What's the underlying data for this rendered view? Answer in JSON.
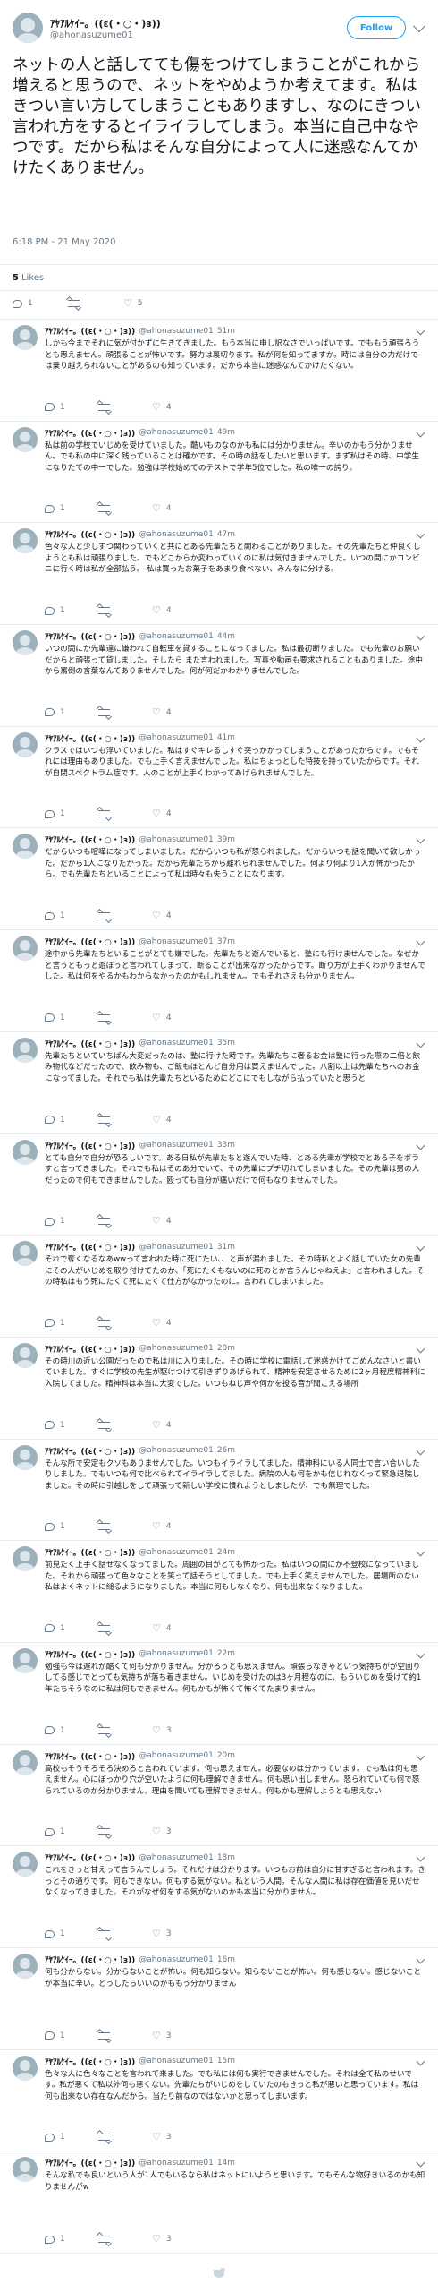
{
  "main_tweet": {
    "display_name": "ｱﾔｱﾙｹｲｰ。((ε(・○・)з))",
    "handle": "@ahonasuzume01",
    "follow_label": "Follow",
    "text": "ネットの人と話してても傷をつけてしまうことがこれから増えると思うので、ネットをやめようか考えてます。私はきつい言い方してしまうこともありますし、なのにきつい言われ方をするとイライラしてしまう。本当に自己中なやつです。だから私はそんな自分によって人に迷惑なんてかけたくありません。",
    "timestamp": "6:18 PM - 21 May 2020",
    "likes_count": "5",
    "likes_label": "Likes",
    "reply_count": "1",
    "retweet_count": "",
    "like_count": "5"
  },
  "replies": [
    {
      "name": "ｱﾔｱﾙｹｲｰ。((ε(・○・)з))",
      "handle": "@ahonasuzume01",
      "time": "51m",
      "text": "しかも今までそれに気が付かずに生きてきました。もう本当に申し訳なさでいっぱいです。でももう頑張ろうとも思えません。頑張ることが怖いです。努力は裏切ります。私が何を知ってますか。時には自分の力だけでは乗り越えられないことがあるのも知っています。だから本当に迷惑なんてかけたくない。",
      "replies": "1",
      "retweets": "",
      "likes": "4"
    },
    {
      "name": "ｱﾔｱﾙｹｲｰ。((ε(・○・)з))",
      "handle": "@ahonasuzume01",
      "time": "49m",
      "text": "私は前の学校でいじめを受けていました。酷いものなのかも私には分かりません。辛いのかもう分かりません。でも私の中に深く残っていることは確かです。その時の話をしたいと思います。まず私はその時、中学生になりたての中一でした。勉強は学校始めてのテストで学年5位でした。私の唯一の誇り。",
      "replies": "1",
      "retweets": "",
      "likes": "4"
    },
    {
      "name": "ｱﾔｱﾙｹｲｰ。((ε(・○・)з))",
      "handle": "@ahonasuzume01",
      "time": "47m",
      "text": "色々な人と少しずつ関わっていくと共にとある先輩たちと関わることがありました。その先輩たちと仲良くしようとも私は頑張りました。でもどこからか変わっていくのに私は気付きませんでした。いつの間にかコンビニに行く時は私が全部払う。\n私は買ったお菓子をあまり食べない、みんなに分ける。",
      "replies": "1",
      "retweets": "",
      "likes": "4"
    },
    {
      "name": "ｱﾔｱﾙｹｲｰ。((ε(・○・)з))",
      "handle": "@ahonasuzume01",
      "time": "44m",
      "text": "いつの間にか先輩達に嫌われて自転車を貸することになってました。私は最初断りました。でも先輩のお願いだからと頑張って貸しました。そしたら また言われました。写真や動画も要求されることもありました。途中から罵倒の言葉なんてありませんでした。何が何だかわかりませんでした。",
      "replies": "1",
      "retweets": "",
      "likes": "4"
    },
    {
      "name": "ｱﾔｱﾙｹｲｰ。((ε(・○・)з))",
      "handle": "@ahonasuzume01",
      "time": "41m",
      "text": "クラスではいつも浮いていました。私はすぐキレるしすぐ突っかかってしまうことがあったからです。でもそれには理由もありました。でも上手く言えませんでした。私はちょっとした特技を持っていたからです。それが自閉スペクトラム症です。人のことが上手くわかってあげられませんでした。",
      "replies": "1",
      "retweets": "",
      "likes": "4"
    },
    {
      "name": "ｱﾔｱﾙｹｲｰ。((ε(・○・)з))",
      "handle": "@ahonasuzume01",
      "time": "39m",
      "text": "だからいつも喧嘩になってしまいました。だからいつも私が怒られました。だからいつも話を聞いて欲しかった。だから1人になりたかった。だから先輩たちから離れられませんでした。何より何より1人が怖かったから。でも先輩たちといることによって私は時々も失うことになります。",
      "replies": "1",
      "retweets": "",
      "likes": "4"
    },
    {
      "name": "ｱﾔｱﾙｹｲｰ。((ε(・○・)з))",
      "handle": "@ahonasuzume01",
      "time": "37m",
      "text": "途中から先輩たちといることがとても嫌でした。先輩たちと遊んでいると、塾にも行けませんでした。なぜかと言うともっと遊ぼうと言われてしまって、断ることが出来なかったからです。断り方が上手くわかりませんでした。私は何をやるかもわからなかったのかもしれません。でもそれさえも分かりません。",
      "replies": "1",
      "retweets": "",
      "likes": "4"
    },
    {
      "name": "ｱﾔｱﾙｹｲｰ。((ε(・○・)з))",
      "handle": "@ahonasuzume01",
      "time": "35m",
      "text": "先輩たちといていちばん大変だったのは、塾に行けた時です。先輩たちに奢るお金は塾に行った際の二倍と飲み物代などだったので、飲み物も、ご飯もほとんど自分用は買えませんでした。八割以上は先輩たちへのお金になってました。それでも私は先輩たちといるためにどこにでもしながら払っていたと思うと",
      "replies": "1",
      "retweets": "",
      "likes": "4"
    },
    {
      "name": "ｱﾔｱﾙｹｲｰ。((ε(・○・)з))",
      "handle": "@ahonasuzume01",
      "time": "33m",
      "text": "とても自分で自分が恐ろしいです。ある日私が先輩たちと遊んでいた時、とある先輩が学校でとある子をボラすと言ってきました。それでも私はそのあ分でいて、その先輩にブチ切れてしまいました。その先輩は男の人だったので何もできませんでした。殴っても自分が痛いだけで何もなりませんでした。",
      "replies": "1",
      "retweets": "",
      "likes": "4"
    },
    {
      "name": "ｱﾔｱﾙｹｲｰ。((ε(・○・)з))",
      "handle": "@ahonasuzume01",
      "time": "31m",
      "text": "それで奪くなるなあwwって言われた時に死にたい、、と声が漏れました。その時私とよく話していた女の先輩にその人がいじめを取り付けてたのか、「死にたくもないのに死のとか言うんじゃねえよ」と言われました。その時私はもう死にたくて死にたくて仕方がなかったのに。言われてしまいました。",
      "replies": "1",
      "retweets": "",
      "likes": "4"
    },
    {
      "name": "ｱﾔｱﾙｹｲｰ。((ε(・○・)з))",
      "handle": "@ahonasuzume01",
      "time": "28m",
      "text": "その時川の近い公園だったので私は川に入りました。その時に学校に電話して迷惑かけてごめんなさいと書いていました。すぐに学校の先生が駆けつけて引きずりあげられて、精神を安定させるために2ヶ月程度精神科に入院してました。精神科は本当に大変でした。いつもねじ声や何かを投る音が聞こえる場所",
      "replies": "1",
      "retweets": "",
      "likes": "4"
    },
    {
      "name": "ｱﾔｱﾙｹｲｰ。((ε(・○・)з))",
      "handle": "@ahonasuzume01",
      "time": "26m",
      "text": "そんな所で安定もクソもありませんでした。いつもイライラしてました。精神科にいる人同士で言い合いしたりしました。でもいつも何で比べられてイライラしてました。病院の人も何をかも信じれなくって緊急退院しました。その時に引越しをして頑張って新しい学校に慣れようとしましたが、でも無理でした。",
      "replies": "1",
      "retweets": "",
      "likes": "4"
    },
    {
      "name": "ｱﾔｱﾙｹｲｰ。((ε(・○・)з))",
      "handle": "@ahonasuzume01",
      "time": "24m",
      "text": "前見たく上手く話せなくなってました。周囲の目がとても怖かった。私はいつの間にか不登校になっていました。それから頑張って色々なことを笑って話そうとしてました。でも上手く笑えませんでした。居場所のない私はよくネットに縋るようになりました。本当に何もしなくなり、何も出来なくなりました。",
      "replies": "1",
      "retweets": "",
      "likes": "4"
    },
    {
      "name": "ｱﾔｱﾙｹｲｰ。((ε(・○・)з))",
      "handle": "@ahonasuzume01",
      "time": "22m",
      "text": "勉強も今は遅れが酷くて何も分かりません。分かろうとも思えません。頑張らなきゃという気持ちがが空回りしてる感じでとっても気持ちが落ち着きません。いじめを受けたのは3ヶ月程なのに、もういじめを受けて約1年たちそうなのに私は何もできません。何もかもが怖くて怖くてたまりません。",
      "replies": "1",
      "retweets": "",
      "likes": "3"
    },
    {
      "name": "ｱﾔｱﾙｹｲｰ。((ε(・○・)з))",
      "handle": "@ahonasuzume01",
      "time": "20m",
      "text": "高校もそうそろそろ決めろと言われています。何も思えません。必要なのは分かっています。でも私は何も思えません。心にぽっかり穴が空いたように何も理解できません。何も思い出しません。怒られていても何で怒られているのか分かりません。理由を聞いても理解できません。何もかも理解しようとも思えない",
      "replies": "1",
      "retweets": "",
      "likes": "3"
    },
    {
      "name": "ｱﾔｱﾙｹｲｰ。((ε(・○・)з))",
      "handle": "@ahonasuzume01",
      "time": "18m",
      "text": "これをきっと甘えって言うんでしょう。それだけは分かります。いつもお前は自分に甘すぎると言われます。きっとその通りです。何もできない。何もする気がない。私という人間。そんな人間に私は存在価値を見いだせなくなってきました。それがなぜ何をする気がないのかも本当に分かりません。",
      "replies": "1",
      "retweets": "",
      "likes": "3"
    },
    {
      "name": "ｱﾔｱﾙｹｲｰ。((ε(・○・)з))",
      "handle": "@ahonasuzume01",
      "time": "16m",
      "text": "何も分からない。分からないことが怖い。何も知らない。知らないことが怖い。何も感じない。感じないことが本当に辛い。どうしたらいいのかももう分かりません",
      "replies": "1",
      "retweets": "",
      "likes": "3"
    },
    {
      "name": "ｱﾔｱﾙｹｲｰ。((ε(・○・)з))",
      "handle": "@ahonasuzume01",
      "time": "15m",
      "text": "色々な人に色々なことを言われて来ました。でも私には何も実行できませんでした。それは全て私のせいです。私が悪くて私以外何も悪くない。先輩たちがいじめをしていたのもきっと私が悪いと思っています。私は何も出来ない存在なんだから。当たり前なのではないかと思ってしまいます。",
      "replies": "1",
      "retweets": "",
      "likes": "3"
    },
    {
      "name": "ｱﾔｱﾙｹｲｰ。((ε(・○・)з))",
      "handle": "@ahonasuzume01",
      "time": "14m",
      "text": "そんな私でも良いという人が1人でもいるなら私はネットにいようと思います。でもそんな物好きいるのかも知りませんがw",
      "replies": "1",
      "retweets": "",
      "likes": "3"
    }
  ]
}
